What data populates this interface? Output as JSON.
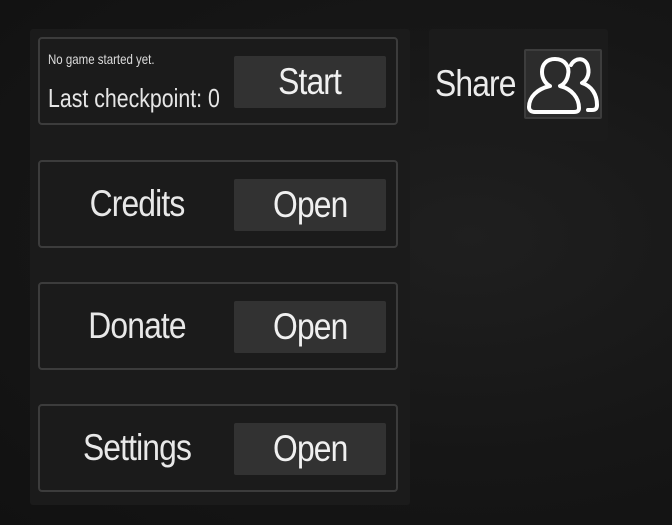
{
  "main_menu": {
    "status": {
      "message": "No game started yet.",
      "checkpoint_text": "Last checkpoint: 0",
      "start_label": "Start"
    },
    "rows": [
      {
        "label": "Credits",
        "button": "Open"
      },
      {
        "label": "Donate",
        "button": "Open"
      },
      {
        "label": "Settings",
        "button": "Open"
      }
    ]
  },
  "share": {
    "label": "Share",
    "icon": "users-icon"
  },
  "colors": {
    "background": "#161616",
    "panel": "#1b1b1b",
    "button": "#323232",
    "border": "#3c3c3c",
    "text": "#ececec"
  }
}
